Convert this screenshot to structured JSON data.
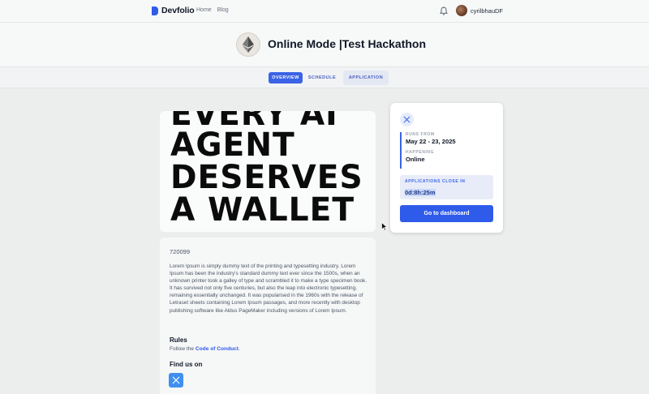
{
  "nav": {
    "brand": "Devfolio",
    "links": [
      "Home",
      "Blog"
    ],
    "username": "cyrilbhauDF",
    "icons": {
      "bell": "bell-icon",
      "brand": "devfolio-logo"
    }
  },
  "hero": {
    "title": "Online Mode |Test Hackathon",
    "logo_icon": "ethereum-logo"
  },
  "tabs": [
    {
      "label": "OVERVIEW",
      "active": true
    },
    {
      "label": "SCHEDULE",
      "active": false
    },
    {
      "label": "APPLICATION",
      "active": false
    }
  ],
  "banner": {
    "lines": [
      "EVERY AI",
      "AGENT",
      "DESERVES",
      "A WALLET"
    ]
  },
  "about": {
    "id": "720099",
    "description": "Lorem Ipsum is simply dummy text of the printing and typesetting industry. Lorem Ipsum has been the industry's standard dummy text ever since the 1500s, when an unknown printer took a galley of type and scrambled it to make a type specimen book. It has survived not only five centuries, but also the leap into electronic typesetting, remaining essentially unchanged. It was popularised in the 1960s with the release of Letraset sheets containing Lorem Ipsum passages, and more recently with desktop publishing software like Aldus PageMaker including versions of Lorem Ipsum.",
    "rules_heading": "Rules",
    "rules_prefix": "Follow the ",
    "rules_link": "Code of Conduct",
    "rules_suffix": ".",
    "find_heading": "Find us on"
  },
  "side": {
    "runs_from_label": "RUNS FROM",
    "runs_from_value": "May 22 - 23, 2025",
    "happening_label": "HAPPENING",
    "happening_value": "Online",
    "close_label": "APPLICATIONS CLOSE IN",
    "close_value": "0d:8h:25m",
    "cta": "Go to dashboard"
  },
  "colors": {
    "primary": "#2f5bea",
    "x_blue": "#3f8ff0",
    "background": "#eceded"
  }
}
